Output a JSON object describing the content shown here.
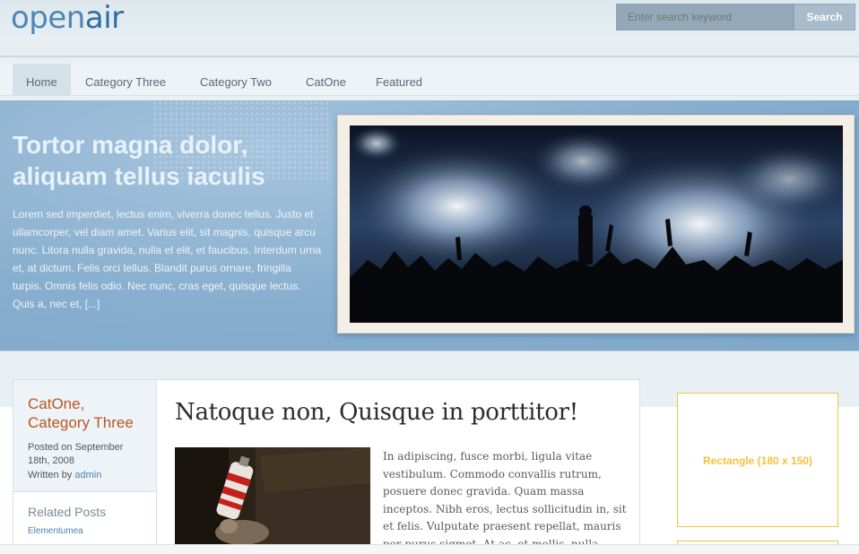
{
  "header": {
    "logo_part1": "open",
    "logo_part2": "air",
    "search_placeholder": "Enter search keyword",
    "search_button": "Search"
  },
  "nav": {
    "items": [
      {
        "label": "Home",
        "active": true
      },
      {
        "label": "Category Three",
        "active": false
      },
      {
        "label": "Category Two",
        "active": false
      },
      {
        "label": "CatOne",
        "active": false
      },
      {
        "label": "Featured",
        "active": false
      }
    ]
  },
  "hero": {
    "title_line1": "Tortor magna dolor,",
    "title_line2": "aliquam tellus iaculis",
    "body": "Lorem sed imperdiet, lectus enim, viverra donec tellus. Justo et ullamcorper, vel diam amet. Varius elit, sit magnis, quisque arcu nunc. Litora nulla gravida, nulla et elit, et faucibus. Interdum urna et, at dictum. Felis orci tellus. Blandit purus ornare, fringilla turpis. Omnis felis odio. Nec nunc, cras eget, quisque lectus. Quis a, nec et, [...]"
  },
  "post": {
    "categories_line1": "CatOne,",
    "categories_line2": "Category Three",
    "posted_on": "Posted on September 18th, 2008",
    "written_by_prefix": "Written by",
    "author": "admin",
    "title": "Natoque non, Quisque in porttitor!",
    "excerpt": "In adipiscing, fusce morbi, ligula vitae vestibulum. Commodo convallis rutrum, posuere donec gravida. Quam massa inceptos. Nibh eros, lectus sollicitudin in, sit et felis. Vulputate praesent repellat, mauris per purus sigmet. At ac, et mollis, nulla"
  },
  "related": {
    "title": "Related Posts",
    "first_link": "Elementumea"
  },
  "sidebar": {
    "ad_label": "Rectangle (180 x 150)"
  },
  "colors": {
    "accent": "#4e82b3",
    "category": "#bb5520",
    "ad_border": "#f0c63a"
  }
}
